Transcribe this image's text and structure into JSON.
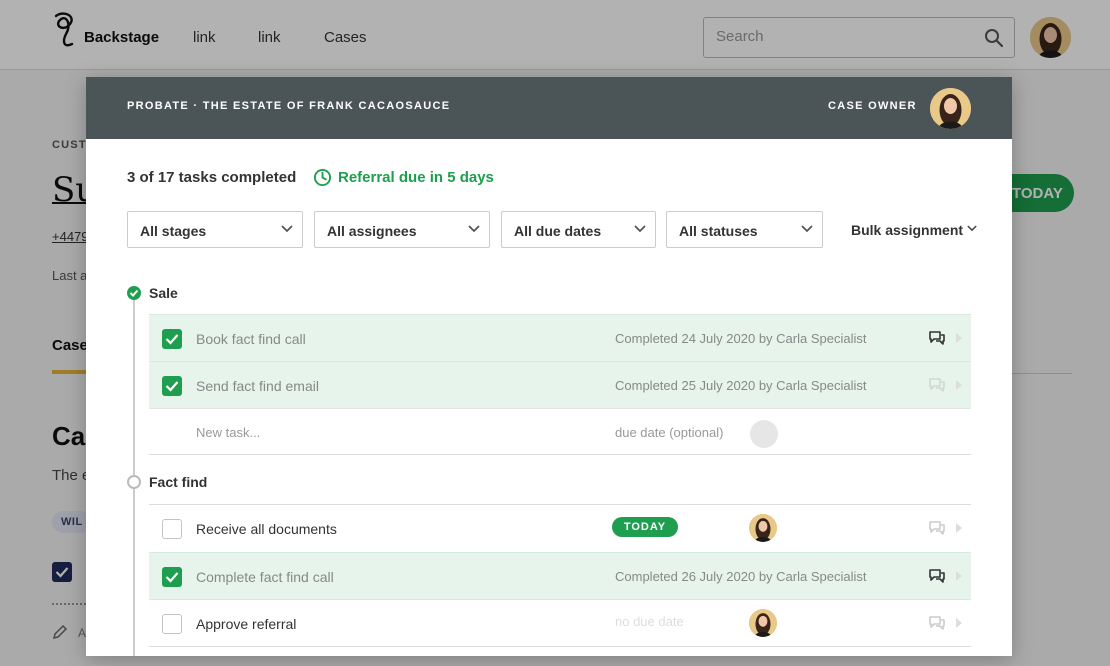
{
  "app": {
    "brand": "Backstage",
    "nav": [
      "link",
      "link",
      "Cases"
    ],
    "search_placeholder": "Search"
  },
  "background": {
    "customer_label": "CUST",
    "customer_name": "Su",
    "phone": "+4479",
    "last": "Last a",
    "tab": "Case",
    "heading": "Ca",
    "description": "The e",
    "pill": "WIL",
    "pencil_label": "A",
    "today_button": "TODAY"
  },
  "modal": {
    "title": "PROBATE · THE ESTATE OF FRANK CACAOSAUCE",
    "case_owner_label": "CASE OWNER",
    "progress": "3 of 17 tasks completed",
    "referral": "Referral due in 5 days",
    "filters": [
      "All stages",
      "All assignees",
      "All due dates",
      "All statuses"
    ],
    "bulk_label": "Bulk assignment",
    "stages": [
      {
        "name": "Sale",
        "complete": true,
        "tasks": [
          {
            "name": "Book fact find call",
            "status": "Completed 24 July 2020 by Carla Specialist",
            "done": true
          },
          {
            "name": "Send fact find email",
            "status": "Completed 25 July 2020 by Carla Specialist",
            "done": true
          }
        ],
        "new_task": {
          "placeholder": "New task...",
          "due_placeholder": "due date (optional)"
        }
      },
      {
        "name": "Fact find",
        "complete": false,
        "tasks": [
          {
            "name": "Receive all documents",
            "badge": "TODAY",
            "done": false
          },
          {
            "name": "Complete fact find call",
            "status": "Completed 26 July 2020 by Carla Specialist",
            "done": true
          },
          {
            "name": "Approve referral",
            "status": "no due date",
            "done": false
          }
        ]
      }
    ]
  },
  "colors": {
    "accent_green": "#1e9e4e",
    "completed_row_bg": "#e6f4ec",
    "modal_header": "#4b5457",
    "tab_underline": "#e8b33c"
  },
  "icons": [
    "logo-icon",
    "search-icon",
    "clock-icon",
    "chevron-down-icon",
    "check-icon",
    "comment-icon",
    "arrow-right-icon",
    "pencil-icon"
  ]
}
